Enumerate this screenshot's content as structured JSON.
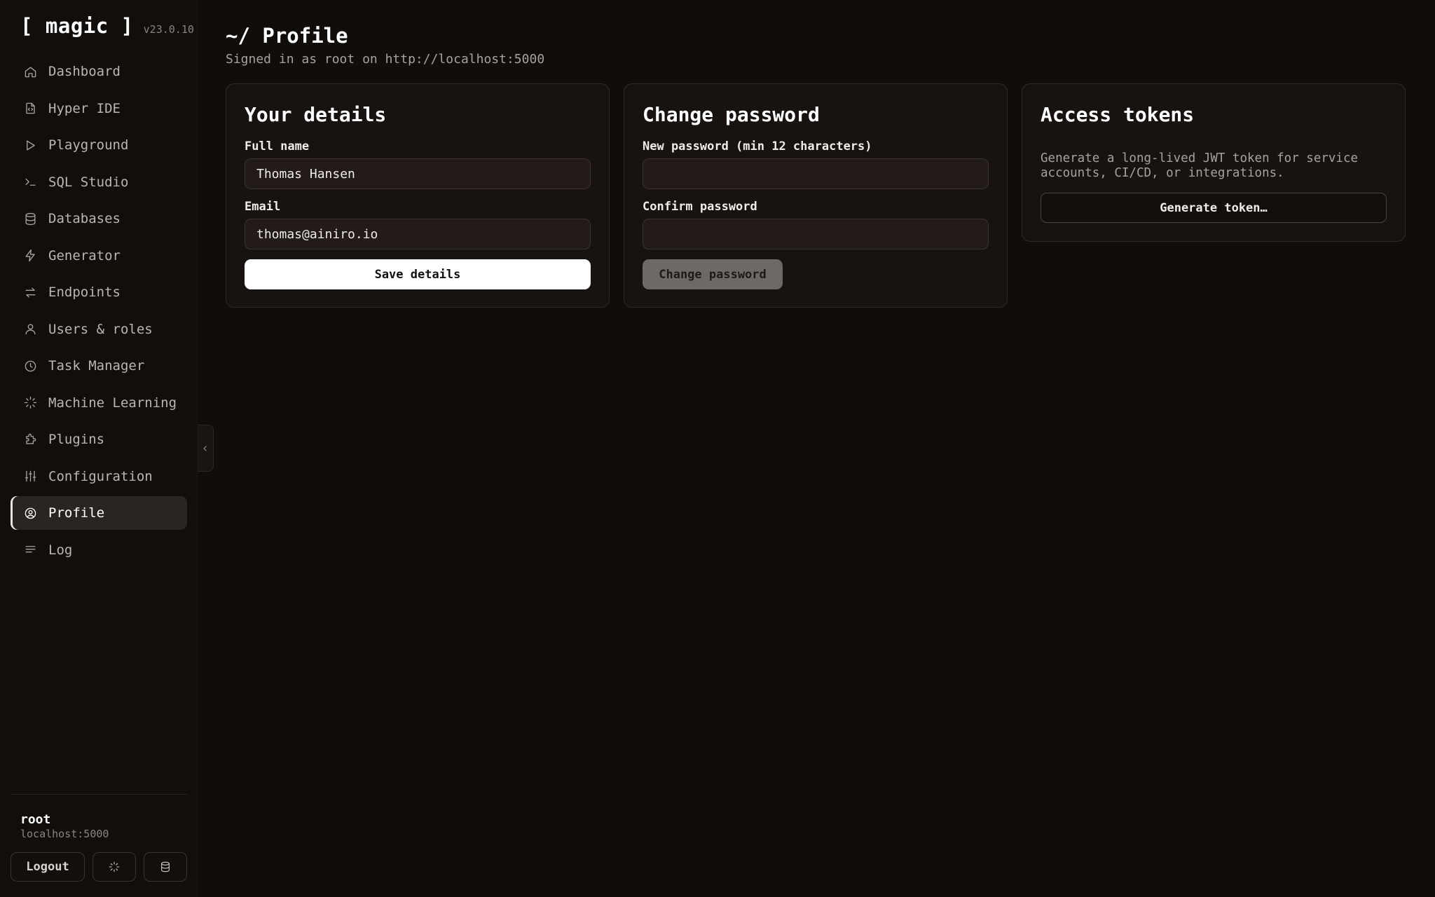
{
  "brand": {
    "name": "[ magic ]",
    "version": "v23.0.10"
  },
  "sidebar": {
    "items": [
      {
        "label": "Dashboard",
        "icon": "home-icon"
      },
      {
        "label": "Hyper IDE",
        "icon": "code-file-icon"
      },
      {
        "label": "Playground",
        "icon": "play-icon"
      },
      {
        "label": "SQL Studio",
        "icon": "terminal-icon"
      },
      {
        "label": "Databases",
        "icon": "database-icon"
      },
      {
        "label": "Generator",
        "icon": "lightning-icon"
      },
      {
        "label": "Endpoints",
        "icon": "arrows-icon"
      },
      {
        "label": "Users & roles",
        "icon": "user-icon"
      },
      {
        "label": "Task Manager",
        "icon": "clock-icon"
      },
      {
        "label": "Machine Learning",
        "icon": "loader-icon"
      },
      {
        "label": "Plugins",
        "icon": "puzzle-icon"
      },
      {
        "label": "Configuration",
        "icon": "sliders-icon"
      },
      {
        "label": "Profile",
        "icon": "user-circle-icon",
        "active": true
      },
      {
        "label": "Log",
        "icon": "list-icon"
      }
    ]
  },
  "footer": {
    "user": "root",
    "host": "localhost:5000",
    "logout_label": "Logout"
  },
  "header": {
    "title": "~/ Profile",
    "subtitle": "Signed in as root on http://localhost:5000"
  },
  "details": {
    "title": "Your details",
    "full_name_label": "Full name",
    "full_name_value": "Thomas Hansen",
    "email_label": "Email",
    "email_value": "thomas@ainiro.io",
    "save_label": "Save details"
  },
  "password": {
    "title": "Change password",
    "new_label": "New password (min 12 characters)",
    "confirm_label": "Confirm password",
    "button_label": "Change password"
  },
  "tokens": {
    "title": "Access tokens",
    "description": "Generate a long-lived JWT token for service accounts, CI/CD, or integrations.",
    "button_label": "Generate token…"
  },
  "colors": {
    "background": "#110d0b",
    "card": "#181310",
    "active_nav": "#2a2522",
    "primary_button": "#ffffff",
    "disabled_button": "#6e6966"
  }
}
